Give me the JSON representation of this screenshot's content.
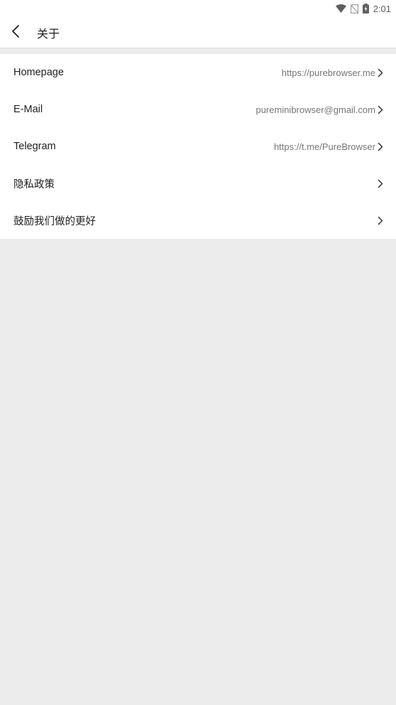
{
  "status_bar": {
    "time": "2:01",
    "icons": [
      "wifi-icon",
      "no-sim-icon",
      "battery-charging-icon"
    ]
  },
  "header": {
    "back_icon": "chevron-left-icon",
    "title": "关于"
  },
  "items": [
    {
      "label": "Homepage",
      "value": "https://purebrowser.me"
    },
    {
      "label": "E-Mail",
      "value": "pureminibrowser@gmail.com"
    },
    {
      "label": "Telegram",
      "value": "https://t.me/PureBrowser"
    },
    {
      "label": "隐私政策",
      "value": ""
    },
    {
      "label": "鼓励我们做的更好",
      "value": ""
    }
  ],
  "colors": {
    "background": "#ececec",
    "surface": "#ffffff",
    "primary_text": "#212121",
    "secondary_text": "#777777"
  }
}
